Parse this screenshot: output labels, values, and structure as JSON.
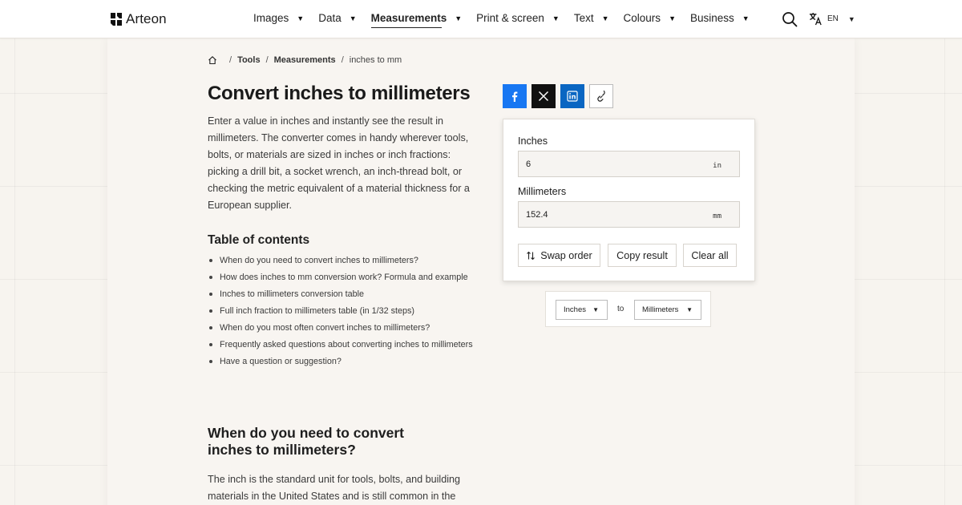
{
  "brand": {
    "name": "Arteon"
  },
  "nav": {
    "menu": [
      {
        "label": "Images"
      },
      {
        "label": "Data"
      },
      {
        "label": "Measurements"
      },
      {
        "label": "Print & screen"
      },
      {
        "label": "Text"
      },
      {
        "label": "Colours"
      },
      {
        "label": "Business"
      }
    ],
    "active": "Measurements",
    "lang": "EN",
    "search_icon": "search-icon",
    "lang_icon": "translate-icon"
  },
  "breadcrumb": {
    "items": [
      "Tools",
      "Measurements"
    ],
    "current": "inches to mm"
  },
  "page": {
    "title": "Convert inches to millimeters",
    "intro": "Enter a value in inches and instantly see the result in millimeters. The converter comes in handy wherever tools, bolts, or materials are sized in inches or inch fractions: picking a drill bit, a socket wrench, an inch-thread bolt, or checking the metric equivalent of a material thickness for a European supplier."
  },
  "toc": {
    "title": "Table of contents",
    "items": [
      "When do you need to convert inches to millimeters?",
      "How does inches to mm conversion work? Formula and example",
      "Inches to millimeters conversion table",
      "Full inch fraction to millimeters table (in 1/32 steps)",
      "When do you most often convert inches to millimeters?",
      "Frequently asked questions about converting inches to millimeters",
      "Have a question or suggestion?"
    ]
  },
  "section": {
    "heading": "When do you need to convert inches to millimeters?",
    "text": "The inch is the standard unit for tools, bolts, and building materials in the United States and is still common in the"
  },
  "share": [
    "facebook-icon",
    "x-icon",
    "linkedin-icon",
    "link-icon"
  ],
  "converter": {
    "from_label": "Inches",
    "from_value": "6",
    "from_unit": "in",
    "to_label": "Millimeters",
    "to_value": "152.4",
    "to_unit": "mm",
    "buttons": {
      "swap": "Swap order",
      "copy": "Copy result",
      "clear": "Clear all"
    }
  },
  "unit_selector": {
    "from": "Inches",
    "to_word": "to",
    "to": "Millimeters"
  },
  "colors": {
    "facebook": "#1877f2",
    "x": "#111111",
    "linkedin": "#0a66c2",
    "page_bg": "#f7f4ef"
  }
}
